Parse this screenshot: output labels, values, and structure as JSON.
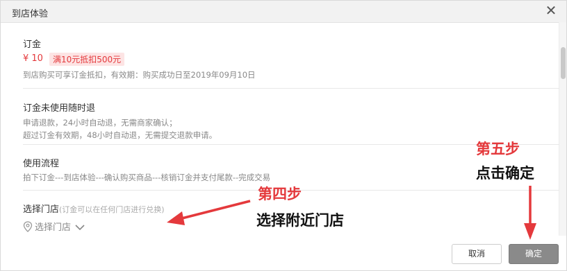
{
  "dialog": {
    "title": "到店体验",
    "close_label": "✕"
  },
  "deposit": {
    "heading": "订金",
    "price": "¥ 10",
    "tag": "满10元抵扣500元",
    "note": "到店购买可享订金抵扣，有效期：购买成功日至2019年09月10日"
  },
  "refund": {
    "heading": "订金未使用随时退",
    "line1": "申请退款，24小时自动退，无需商家确认；",
    "line2": "超过订金有效期，48小时自动退，无需提交退款申请。"
  },
  "process": {
    "heading": "使用流程",
    "steps": "拍下订金---到店体验---确认购买商品---核销订金并支付尾款--完成交易"
  },
  "store": {
    "heading": "选择门店",
    "hint": "(订金可以在任何门店进行兑换)",
    "select_label": "选择门店"
  },
  "footer": {
    "cancel_label": "取消",
    "confirm_label": "确定"
  },
  "annotations": {
    "step4_title": "第四步",
    "step4_text": "选择附近门店",
    "step5_title": "第五步",
    "step5_text": "点击确定"
  },
  "icons": {
    "close": "close-icon",
    "location": "location-pin-icon",
    "dropdown": "chevron-down-icon"
  },
  "colors": {
    "accent_red": "#e4393c",
    "confirm_button": "#8a8a8a"
  }
}
